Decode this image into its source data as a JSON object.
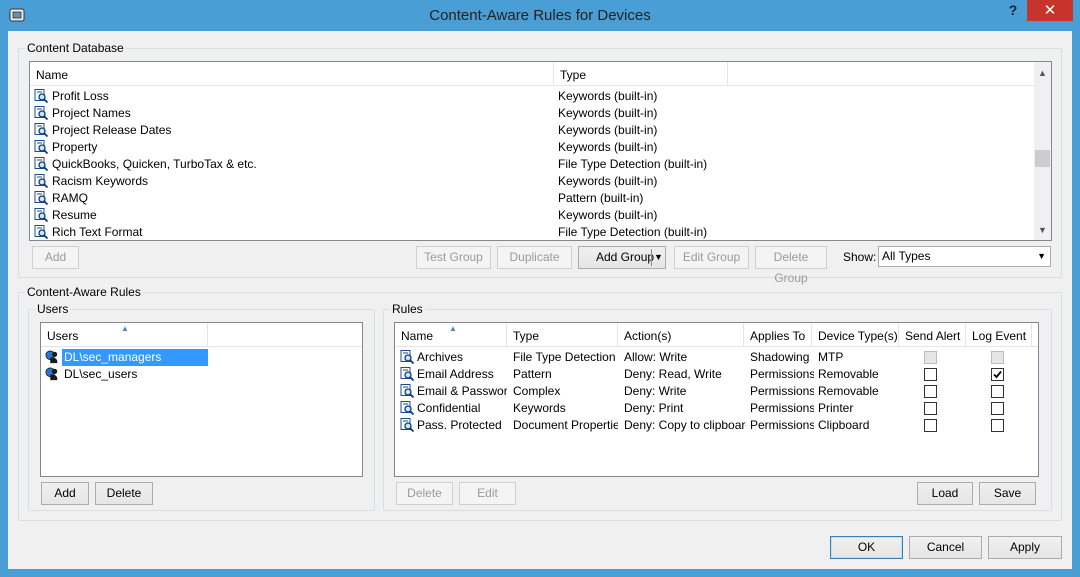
{
  "window": {
    "title": "Content-Aware Rules for Devices",
    "help_label": "?",
    "close_label": "✕"
  },
  "content_db": {
    "group_label": "Content Database",
    "columns": [
      "Name",
      "Type"
    ],
    "rows": [
      {
        "name": "Profit Loss",
        "type": "Keywords (built-in)"
      },
      {
        "name": "Project Names",
        "type": "Keywords (built-in)"
      },
      {
        "name": "Project Release Dates",
        "type": "Keywords (built-in)"
      },
      {
        "name": "Property",
        "type": "Keywords (built-in)"
      },
      {
        "name": "QuickBooks, Quicken, TurboTax & etc.",
        "type": "File Type Detection (built-in)"
      },
      {
        "name": "Racism Keywords",
        "type": "Keywords (built-in)"
      },
      {
        "name": "RAMQ",
        "type": "Pattern (built-in)"
      },
      {
        "name": "Resume",
        "type": "Keywords (built-in)"
      },
      {
        "name": "Rich Text Format",
        "type": "File Type Detection (built-in)"
      }
    ],
    "buttons": {
      "add": "Add",
      "test_group": "Test Group",
      "duplicate": "Duplicate",
      "add_group": "Add Group",
      "edit_group": "Edit Group",
      "delete_group": "Delete Group"
    },
    "show_label": "Show:",
    "show_value": "All Types"
  },
  "rules_section": {
    "group_label": "Content-Aware Rules",
    "users": {
      "group_label": "Users",
      "column": "Users",
      "items": [
        "DL\\sec_managers",
        "DL\\sec_users"
      ],
      "selected_index": 0,
      "add_label": "Add",
      "delete_label": "Delete"
    },
    "rules": {
      "group_label": "Rules",
      "columns": [
        "Name",
        "Type",
        "Action(s)",
        "Applies To",
        "Device Type(s)",
        "Send Alert",
        "Log Event"
      ],
      "rows": [
        {
          "name": "Archives",
          "type": "File Type Detection",
          "action": "Allow: Write",
          "applies": "Shadowing",
          "device": "MTP",
          "send_alert": false,
          "log_event": false,
          "disabled": true
        },
        {
          "name": "Email Address",
          "type": "Pattern",
          "action": "Deny: Read, Write",
          "applies": "Permissions",
          "device": "Removable",
          "send_alert": false,
          "log_event": true,
          "disabled": false
        },
        {
          "name": "Email & Passwords",
          "type": "Complex",
          "action": "Deny: Write",
          "applies": "Permissions",
          "device": "Removable",
          "send_alert": false,
          "log_event": false,
          "disabled": false
        },
        {
          "name": "Confidential",
          "type": "Keywords",
          "action": "Deny: Print",
          "applies": "Permissions",
          "device": "Printer",
          "send_alert": false,
          "log_event": false,
          "disabled": false
        },
        {
          "name": "Pass. Protected",
          "type": "Document Properties",
          "action": "Deny: Copy to clipboard",
          "applies": "Permissions",
          "device": "Clipboard",
          "send_alert": false,
          "log_event": false,
          "disabled": false
        }
      ],
      "delete_label": "Delete",
      "edit_label": "Edit",
      "load_label": "Load",
      "save_label": "Save"
    }
  },
  "footer": {
    "ok": "OK",
    "cancel": "Cancel",
    "apply": "Apply"
  },
  "icons": {
    "app": "shield-device-icon",
    "rule": "document-magnifier-icon",
    "user": "user-group-icon"
  },
  "colors": {
    "titlebar": "#4a9ed6",
    "close": "#c7342b",
    "selection": "#3399ff"
  }
}
